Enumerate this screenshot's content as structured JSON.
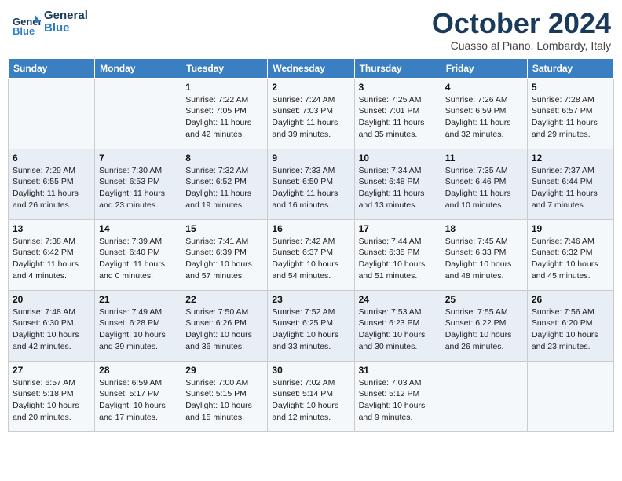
{
  "header": {
    "logo_line1": "General",
    "logo_line2": "Blue",
    "month": "October 2024",
    "location": "Cuasso al Piano, Lombardy, Italy"
  },
  "days_of_week": [
    "Sunday",
    "Monday",
    "Tuesday",
    "Wednesday",
    "Thursday",
    "Friday",
    "Saturday"
  ],
  "weeks": [
    [
      {
        "day": "",
        "info": ""
      },
      {
        "day": "",
        "info": ""
      },
      {
        "day": "1",
        "info": "Sunrise: 7:22 AM\nSunset: 7:05 PM\nDaylight: 11 hours and 42 minutes."
      },
      {
        "day": "2",
        "info": "Sunrise: 7:24 AM\nSunset: 7:03 PM\nDaylight: 11 hours and 39 minutes."
      },
      {
        "day": "3",
        "info": "Sunrise: 7:25 AM\nSunset: 7:01 PM\nDaylight: 11 hours and 35 minutes."
      },
      {
        "day": "4",
        "info": "Sunrise: 7:26 AM\nSunset: 6:59 PM\nDaylight: 11 hours and 32 minutes."
      },
      {
        "day": "5",
        "info": "Sunrise: 7:28 AM\nSunset: 6:57 PM\nDaylight: 11 hours and 29 minutes."
      }
    ],
    [
      {
        "day": "6",
        "info": "Sunrise: 7:29 AM\nSunset: 6:55 PM\nDaylight: 11 hours and 26 minutes."
      },
      {
        "day": "7",
        "info": "Sunrise: 7:30 AM\nSunset: 6:53 PM\nDaylight: 11 hours and 23 minutes."
      },
      {
        "day": "8",
        "info": "Sunrise: 7:32 AM\nSunset: 6:52 PM\nDaylight: 11 hours and 19 minutes."
      },
      {
        "day": "9",
        "info": "Sunrise: 7:33 AM\nSunset: 6:50 PM\nDaylight: 11 hours and 16 minutes."
      },
      {
        "day": "10",
        "info": "Sunrise: 7:34 AM\nSunset: 6:48 PM\nDaylight: 11 hours and 13 minutes."
      },
      {
        "day": "11",
        "info": "Sunrise: 7:35 AM\nSunset: 6:46 PM\nDaylight: 11 hours and 10 minutes."
      },
      {
        "day": "12",
        "info": "Sunrise: 7:37 AM\nSunset: 6:44 PM\nDaylight: 11 hours and 7 minutes."
      }
    ],
    [
      {
        "day": "13",
        "info": "Sunrise: 7:38 AM\nSunset: 6:42 PM\nDaylight: 11 hours and 4 minutes."
      },
      {
        "day": "14",
        "info": "Sunrise: 7:39 AM\nSunset: 6:40 PM\nDaylight: 11 hours and 0 minutes."
      },
      {
        "day": "15",
        "info": "Sunrise: 7:41 AM\nSunset: 6:39 PM\nDaylight: 10 hours and 57 minutes."
      },
      {
        "day": "16",
        "info": "Sunrise: 7:42 AM\nSunset: 6:37 PM\nDaylight: 10 hours and 54 minutes."
      },
      {
        "day": "17",
        "info": "Sunrise: 7:44 AM\nSunset: 6:35 PM\nDaylight: 10 hours and 51 minutes."
      },
      {
        "day": "18",
        "info": "Sunrise: 7:45 AM\nSunset: 6:33 PM\nDaylight: 10 hours and 48 minutes."
      },
      {
        "day": "19",
        "info": "Sunrise: 7:46 AM\nSunset: 6:32 PM\nDaylight: 10 hours and 45 minutes."
      }
    ],
    [
      {
        "day": "20",
        "info": "Sunrise: 7:48 AM\nSunset: 6:30 PM\nDaylight: 10 hours and 42 minutes."
      },
      {
        "day": "21",
        "info": "Sunrise: 7:49 AM\nSunset: 6:28 PM\nDaylight: 10 hours and 39 minutes."
      },
      {
        "day": "22",
        "info": "Sunrise: 7:50 AM\nSunset: 6:26 PM\nDaylight: 10 hours and 36 minutes."
      },
      {
        "day": "23",
        "info": "Sunrise: 7:52 AM\nSunset: 6:25 PM\nDaylight: 10 hours and 33 minutes."
      },
      {
        "day": "24",
        "info": "Sunrise: 7:53 AM\nSunset: 6:23 PM\nDaylight: 10 hours and 30 minutes."
      },
      {
        "day": "25",
        "info": "Sunrise: 7:55 AM\nSunset: 6:22 PM\nDaylight: 10 hours and 26 minutes."
      },
      {
        "day": "26",
        "info": "Sunrise: 7:56 AM\nSunset: 6:20 PM\nDaylight: 10 hours and 23 minutes."
      }
    ],
    [
      {
        "day": "27",
        "info": "Sunrise: 6:57 AM\nSunset: 5:18 PM\nDaylight: 10 hours and 20 minutes."
      },
      {
        "day": "28",
        "info": "Sunrise: 6:59 AM\nSunset: 5:17 PM\nDaylight: 10 hours and 17 minutes."
      },
      {
        "day": "29",
        "info": "Sunrise: 7:00 AM\nSunset: 5:15 PM\nDaylight: 10 hours and 15 minutes."
      },
      {
        "day": "30",
        "info": "Sunrise: 7:02 AM\nSunset: 5:14 PM\nDaylight: 10 hours and 12 minutes."
      },
      {
        "day": "31",
        "info": "Sunrise: 7:03 AM\nSunset: 5:12 PM\nDaylight: 10 hours and 9 minutes."
      },
      {
        "day": "",
        "info": ""
      },
      {
        "day": "",
        "info": ""
      }
    ]
  ]
}
